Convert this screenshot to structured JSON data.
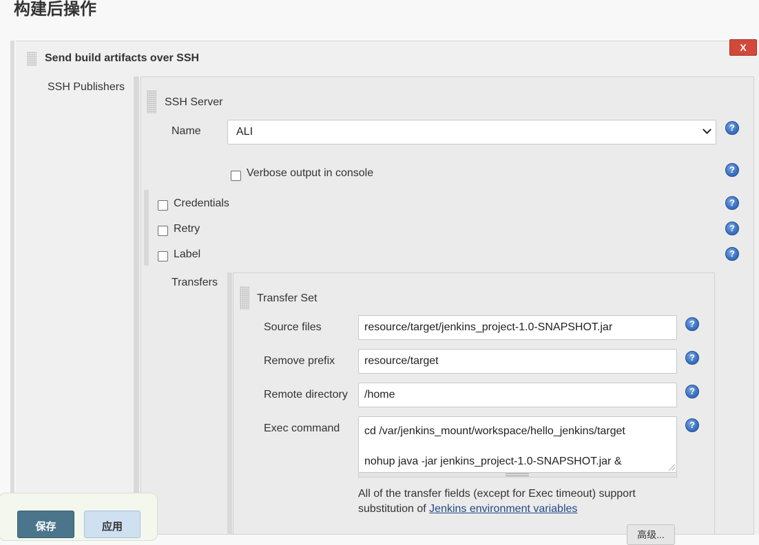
{
  "section_title": "构建后操作",
  "step": {
    "title": "Send build artifacts over SSH",
    "delete_label": "X",
    "publishers_label": "SSH Publishers"
  },
  "server": {
    "title": "SSH Server",
    "name_label": "Name",
    "name_value": "ALI",
    "verbose_label": "Verbose output in console",
    "verbose_checked": false,
    "options": [
      {
        "label": "Credentials",
        "checked": false
      },
      {
        "label": "Retry",
        "checked": false
      },
      {
        "label": "Label",
        "checked": false
      }
    ]
  },
  "transfers": {
    "label": "Transfers",
    "set_title": "Transfer Set",
    "source_files_label": "Source files",
    "source_files_value": "resource/target/jenkins_project-1.0-SNAPSHOT.jar",
    "remove_prefix_label": "Remove prefix",
    "remove_prefix_value": "resource/target",
    "remote_directory_label": "Remote directory",
    "remote_directory_value": "/home",
    "exec_command_label": "Exec command",
    "exec_command_line1": "cd /var/jenkins_mount/workspace/hello_jenkins/target",
    "exec_command_line2": "nohup java -jar  jenkins_project-1.0-SNAPSHOT.jar &",
    "note_prefix": "All of the transfer fields (except for Exec timeout) support",
    "note_middle": "substitution of ",
    "note_link": "Jenkins environment variables",
    "advanced_label": "高级..."
  },
  "help_icon_glyph": "?",
  "footer": {
    "save_label": "保存",
    "apply_label": "应用"
  },
  "colors": {
    "help_icon": "#3e74c6",
    "delete_button": "#d24939",
    "save_button": "#4b758b",
    "apply_button": "#cfe0f1",
    "link": "#204a87"
  }
}
